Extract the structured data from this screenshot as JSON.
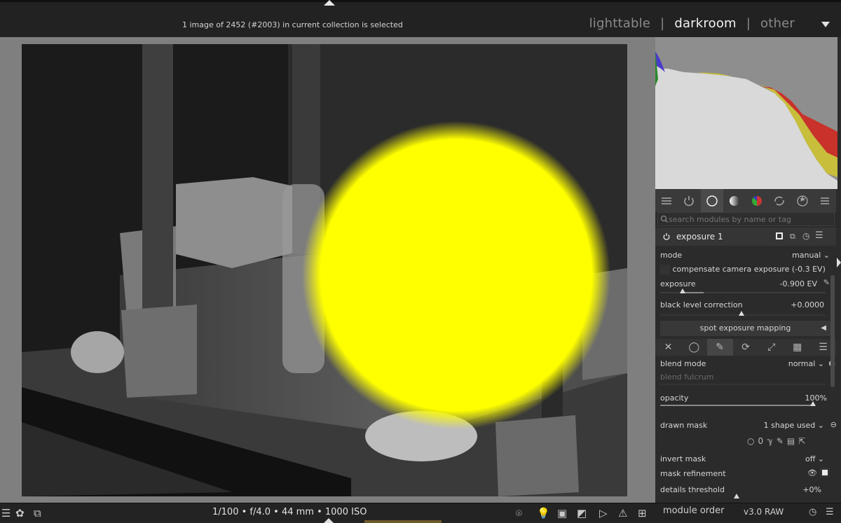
{
  "top": {
    "collection_status": "1 image of 2452 (#2003) in current collection is selected",
    "views": [
      "lighttable",
      "darkroom",
      "other"
    ],
    "active_view": "darkroom"
  },
  "search": {
    "placeholder": "search modules by name or tag"
  },
  "module": {
    "name": "exposure 1",
    "mode_label": "mode",
    "mode_value": "manual",
    "compensate_label": "compensate camera exposure (-0.3 EV)",
    "exposure_label": "exposure",
    "exposure_value": "-0.900 EV",
    "black_level_label": "black level correction",
    "black_level_value": "+0.0000",
    "spot_button": "spot exposure mapping"
  },
  "blending": {
    "blend_mode_label": "blend mode",
    "blend_mode_value": "normal",
    "blend_fulcrum_label": "blend fulcrum",
    "opacity_label": "opacity",
    "opacity_value": "100%",
    "drawn_mask_label": "drawn mask",
    "drawn_mask_value": "1 shape used",
    "invert_mask_label": "invert mask",
    "invert_mask_value": "off",
    "mask_refinement_label": "mask refinement",
    "details_threshold_label": "details threshold",
    "details_threshold_value": "+0%"
  },
  "bottom": {
    "exif": "1/100 • f/4.0 • 44 mm • 1000 ISO",
    "module_order_label": "module order",
    "module_order_value": "v3.0 RAW"
  },
  "colors": {
    "mask_overlay": "#ffff00",
    "histogram_bg": "#8e8e8e",
    "panel_bg": "#2b2b2b"
  }
}
